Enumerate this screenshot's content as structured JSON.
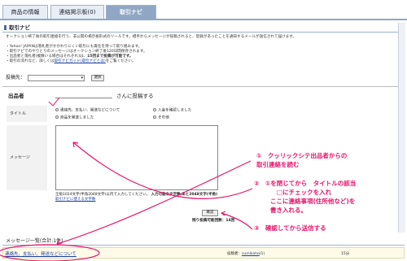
{
  "tabs": [
    {
      "label": "商品の情報"
    },
    {
      "label": "連絡掲示板(0)"
    },
    {
      "label": "取引ナビ"
    }
  ],
  "section_title": "取引ナビ",
  "intro": {
    "line1": "オークション終了後の取引連絡を行う、非公開の掲示板形式のツールです。相手からメッセージが投稿されると、登録があったことを通知するメールが送信されて届けます。",
    "bullet1": "・Yahoo! JAPANは落札者がかかわりにくい取引にも責任を持って取り組みます。",
    "bullet2": "・取引ナビでのやりとりのメッセージはオークション終了後120日間保存されます。",
    "bullet3": "・出品者と落札者(複数いる場合はそれぞれ)は、",
    "bullet3_bold": "15回まで投稿が可能です。",
    "bullet4_prefix": "・取引の流れなど、詳しくは",
    "bullet4_link": "取引ナビガイド(取引ナビとは)",
    "bullet4_suffix": "をご覧ください。"
  },
  "post_target": {
    "label": "投稿先：",
    "select_value": "",
    "choose_button": "選択"
  },
  "seller_row": {
    "label": "出品者",
    "suffix": "さんに投稿する"
  },
  "title_field": {
    "label": "タイトル",
    "options": [
      "連絡先、支払い、発送などについて",
      "入金を確認しました",
      "商品を発送しました",
      "その他"
    ]
  },
  "message_field": {
    "label": "メッセージ",
    "value": ""
  },
  "counter": {
    "text": "全角1024文字(半角2048文字)以内で入力してください。",
    "bold": "入力可能な文字数:あと2048文字(半角)",
    "guide_link": "取引ナビに使える文字数"
  },
  "confirm_button": "確認",
  "remaining": "残り投稿可能回数：14回",
  "list": {
    "header": "メッセージ一覧(合計:1件)",
    "row_title": "連絡先、支払い、発送などについて",
    "poster_label": "投稿者：",
    "poster_link": "sumikaho",
    "poster_suffix": "(1)",
    "date": "15分"
  },
  "annotations": {
    "step1_line1": "①　クッリックシテ出品者からの",
    "step1_line2": "取引連絡を読む",
    "step2_line1": "②　①を閉じてから　タイトルの該当",
    "step2_line2": "□にチェックを入れ",
    "step2_line3": "ここに連絡事項(住所他など)を",
    "step2_line4": "書き入れる。",
    "step3": "③　確認してから送信する"
  },
  "colors": {
    "annotation": "#e8146c",
    "tab_active": "#8fa7c4",
    "link": "#1a3fa6"
  }
}
